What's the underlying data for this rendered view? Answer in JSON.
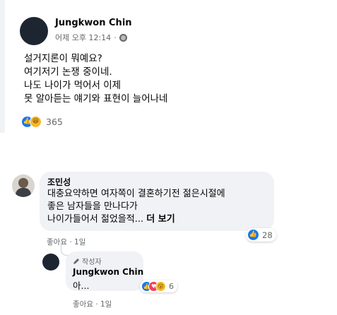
{
  "post": {
    "author": "Jungkwon Chin",
    "timestamp": "어제 오후 12:14",
    "privacy_icon": "globe-icon",
    "lines": [
      "설거지론이 뭐예요?",
      "여기저기 논쟁  중이네.",
      "나도 나이가 먹어서 이제",
      "못 알아듣는 얘기와 표현이 늘어나네"
    ],
    "reaction_count": "365",
    "reaction_icons": [
      "like-icon",
      "haha-icon"
    ]
  },
  "comment1": {
    "author": "조민성",
    "lines": [
      "대충요약하면 여자쪽이 결혼하기전 젊은시절에",
      "좋은 남자들을 만나다가",
      "나이가들어서 젊었을적... "
    ],
    "see_more": "더 보기",
    "reaction_count": "28",
    "actions": "좋아요 · 1일"
  },
  "comment2": {
    "badge": "작성자",
    "author": "Jungkwon Chin",
    "text": "아...",
    "reaction_count": "6",
    "reaction_icons": [
      "like-icon",
      "love-icon",
      "wow-icon"
    ],
    "actions": "좋아요 · 1일"
  },
  "colors": {
    "like": "#1877f2",
    "love": "#f33e58",
    "haha": "#f7b928",
    "bubble": "#f0f2f5",
    "meta_text": "#65676b"
  }
}
